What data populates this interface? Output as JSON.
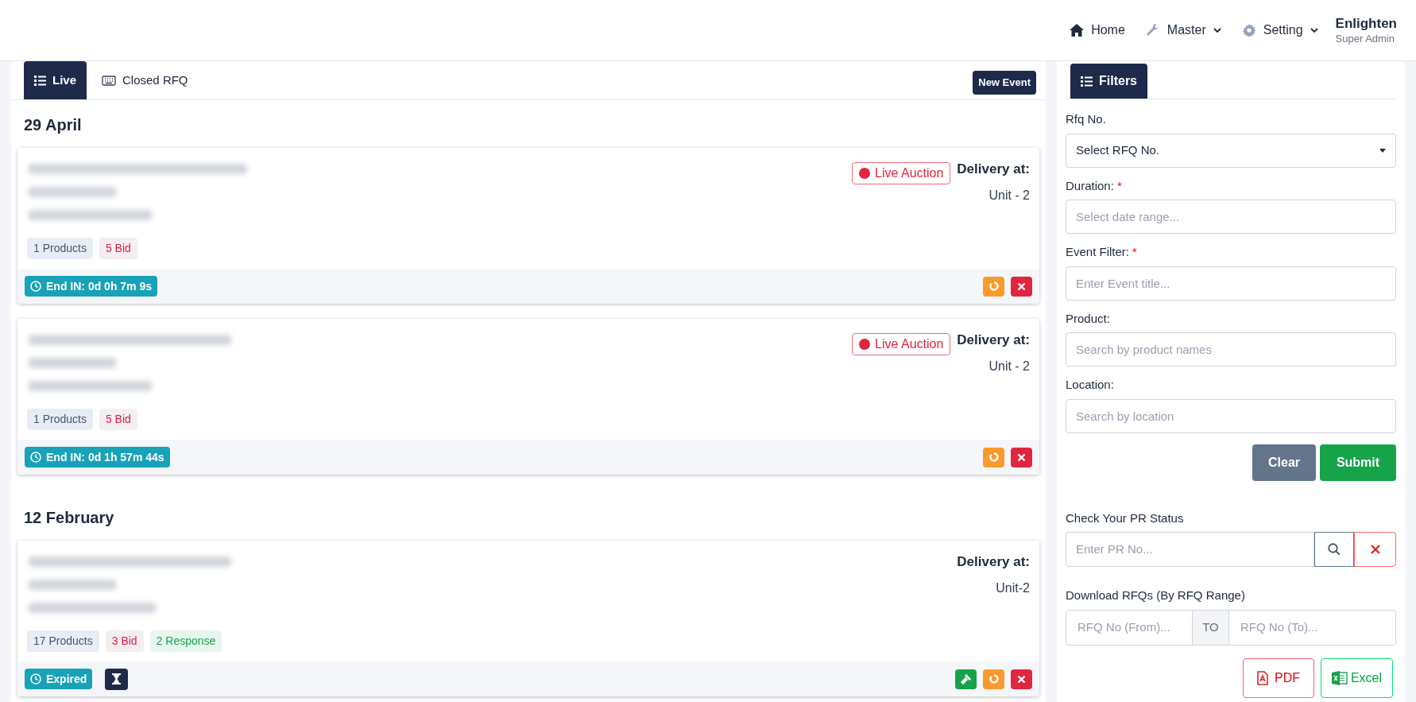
{
  "header": {
    "nav": [
      {
        "kind": "home",
        "label": "Home",
        "dropdown": false
      },
      {
        "kind": "wrench",
        "label": "Master",
        "dropdown": true
      },
      {
        "kind": "gear",
        "label": "Setting",
        "dropdown": true
      }
    ],
    "user": {
      "name": "Enlighten",
      "role": "Super Admin"
    }
  },
  "tabs": [
    {
      "kind": "list",
      "label": "Live",
      "selected": true
    },
    {
      "kind": "keyboard",
      "label": "Closed RFQ",
      "selected": false
    }
  ],
  "new_event_button": "New Event",
  "groups": [
    {
      "date": "29 April",
      "events": [
        {
          "live_badge": "Live Auction",
          "delivery_label": "Delivery at:",
          "delivery": "Unit - 2",
          "tags": [
            {
              "kind": "products",
              "text": "1 Products"
            },
            {
              "kind": "bid",
              "text": "5 Bid"
            }
          ],
          "timer": "End IN: 0d 0h 7m 9s",
          "hourglass": false,
          "actions": [
            {
              "kind": "remind"
            },
            {
              "kind": "delete"
            }
          ]
        },
        {
          "live_badge": "Live Auction",
          "delivery_label": "Delivery at:",
          "delivery": "Unit - 2",
          "tags": [
            {
              "kind": "products",
              "text": "1 Products"
            },
            {
              "kind": "bid",
              "text": "5 Bid"
            }
          ],
          "timer": "End IN: 0d 1h 57m 44s",
          "hourglass": false,
          "actions": [
            {
              "kind": "remind"
            },
            {
              "kind": "delete"
            }
          ]
        }
      ]
    },
    {
      "date": "12 February",
      "events": [
        {
          "delivery_label": "Delivery at:",
          "delivery": "Unit-2",
          "tags": [
            {
              "kind": "products",
              "text": "17 Products"
            },
            {
              "kind": "bid",
              "text": "3 Bid"
            },
            {
              "kind": "response",
              "text": "2 Response"
            }
          ],
          "timer": "Expired",
          "hourglass": true,
          "actions": [
            {
              "kind": "award"
            },
            {
              "kind": "remind"
            },
            {
              "kind": "delete"
            }
          ]
        }
      ]
    }
  ],
  "filters": {
    "tab": "Filters",
    "fields": [
      {
        "kind": "select",
        "label": "Rfq No.",
        "value": "Select RFQ No."
      },
      {
        "kind": "input",
        "label": "Duration:",
        "required_mark": "*",
        "placeholder": "Select date range..."
      },
      {
        "kind": "input",
        "label": "Event Filter:",
        "required_mark": "*",
        "placeholder": "Enter Event title..."
      },
      {
        "kind": "input",
        "label": "Product:",
        "placeholder": "Search by product names"
      },
      {
        "kind": "input",
        "label": "Location:",
        "placeholder": "Search by location"
      }
    ],
    "clear_button": "Clear",
    "submit_button": "Submit"
  },
  "pr_status": {
    "label": "Check Your PR Status",
    "placeholder": "Enter PR No..."
  },
  "download": {
    "label": "Download RFQs (By RFQ Range)",
    "from_placeholder": "RFQ No (From)...",
    "to_label": "TO",
    "to_placeholder": "RFQ No (To)...",
    "pdf_button": "PDF",
    "excel_button": "Excel"
  }
}
